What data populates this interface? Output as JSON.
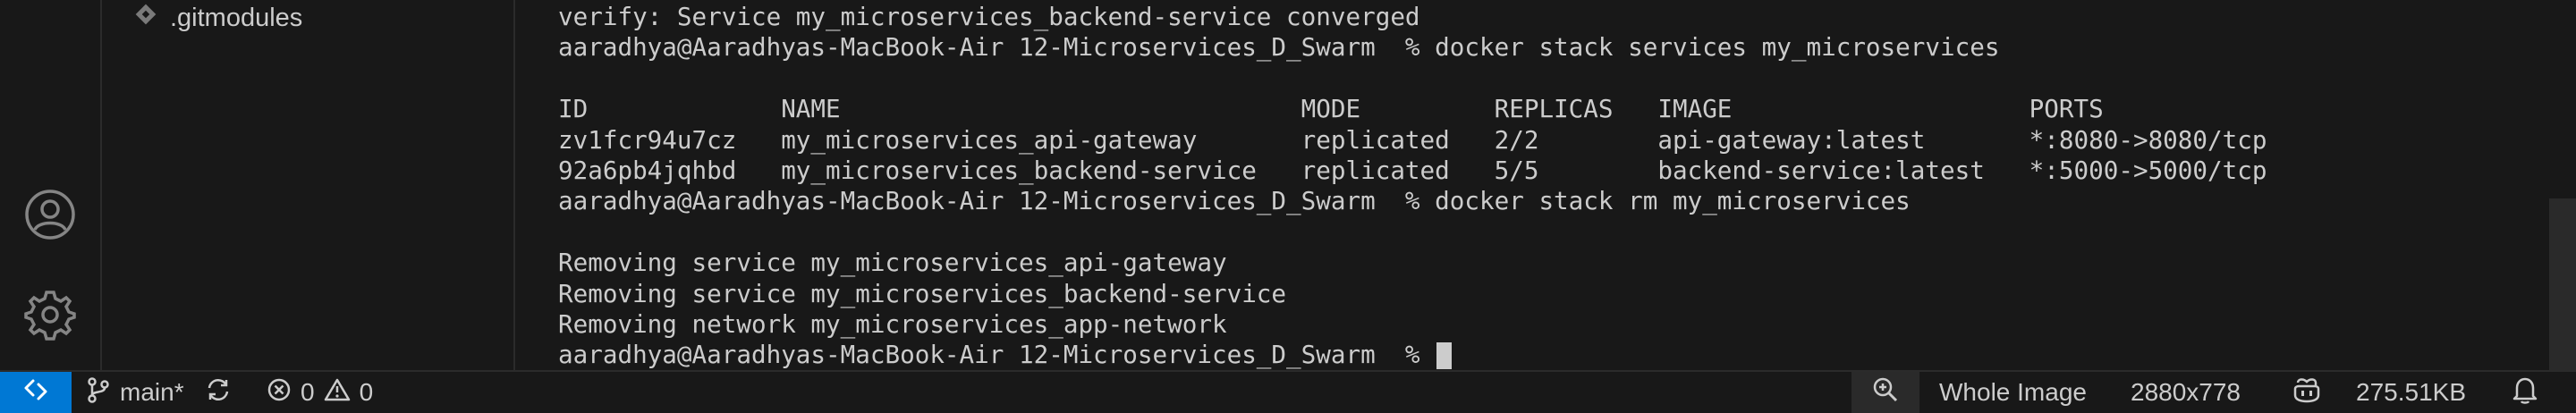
{
  "explorer": {
    "items": [
      {
        "label": ".gitmodules",
        "icon": "git-diamond-icon"
      }
    ]
  },
  "terminal": {
    "lines": [
      "verify: Service my_microservices_backend-service converged",
      "aaradhya@Aaradhyas-MacBook-Air 12-Microservices_D_Swarm  % docker stack services my_microservices",
      "",
      "ID             NAME                               MODE         REPLICAS   IMAGE                    PORTS",
      "zv1fcr94u7cz   my_microservices_api-gateway       replicated   2/2        api-gateway:latest       *:8080->8080/tcp",
      "92a6pb4jqhbd   my_microservices_backend-service   replicated   5/5        backend-service:latest   *:5000->5000/tcp",
      "aaradhya@Aaradhyas-MacBook-Air 12-Microservices_D_Swarm  % docker stack rm my_microservices",
      "",
      "Removing service my_microservices_api-gateway",
      "Removing service my_microservices_backend-service",
      "Removing network my_microservices_app-network"
    ],
    "prompt": "aaradhya@Aaradhyas-MacBook-Air 12-Microservices_D_Swarm  %"
  },
  "status_bar": {
    "branch": "main*",
    "errors": "0",
    "warnings": "0",
    "zoom_mode": "Whole Image",
    "dimensions": "2880x778",
    "file_size": "275.51KB"
  },
  "colors": {
    "background": "#181818",
    "accent": "#0078d4",
    "text": "#cccccc"
  }
}
